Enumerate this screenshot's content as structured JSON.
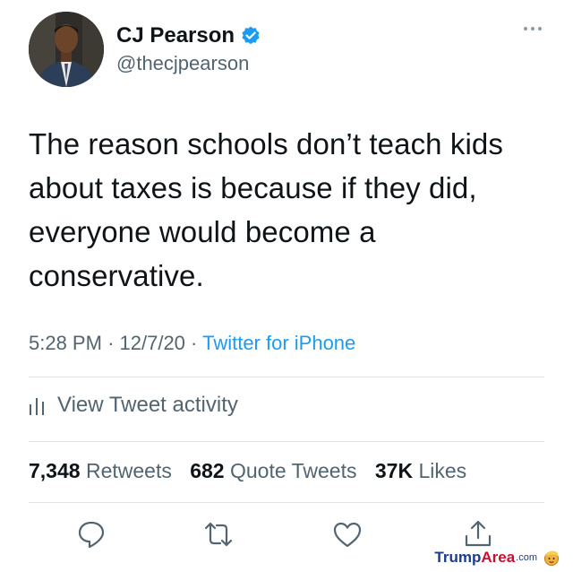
{
  "tweet": {
    "author": {
      "name": "CJ Pearson",
      "handle": "@thecjpearson",
      "verified": true
    },
    "text": "The reason schools don’t teach kids about taxes is because if they did, everyone would become a conservative.",
    "time": "5:28 PM",
    "date": "12/7/20",
    "separator": "·",
    "source": "Twitter for iPhone",
    "activity_label": "View Tweet activity",
    "stats": {
      "retweets_count": "7,348",
      "retweets_label": "Retweets",
      "quotes_count": "682",
      "quotes_label": "Quote Tweets",
      "likes_count": "37K",
      "likes_label": "Likes"
    }
  },
  "actions": [
    "reply-icon",
    "retweet-icon",
    "like-icon",
    "share-icon"
  ],
  "watermark": {
    "part1": "Trump",
    "part2": "Area",
    "part3": ".com"
  },
  "colors": {
    "text": "#0f1419",
    "secondary": "#536471",
    "link": "#1d9bf0",
    "verified": "#1d9bf0",
    "divider": "#dfe3e6"
  }
}
